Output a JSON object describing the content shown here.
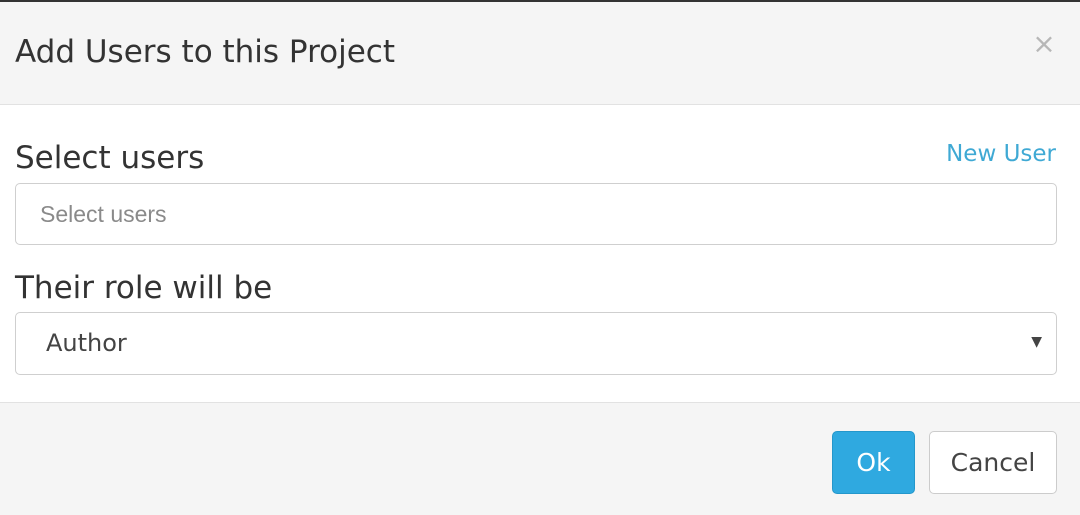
{
  "dialog": {
    "title": "Add Users to this Project",
    "close_symbol": "×"
  },
  "users_field": {
    "label": "Select users",
    "placeholder": "Select users",
    "value": "",
    "new_user_link": "New User"
  },
  "role_field": {
    "label": "Their role will be",
    "selected": "Author",
    "caret_icon": "caret-down-icon"
  },
  "footer": {
    "ok_label": "Ok",
    "cancel_label": "Cancel"
  },
  "colors": {
    "accent": "#2fa9e0",
    "link": "#3fa9d4",
    "header_background": "#f5f5f5"
  }
}
